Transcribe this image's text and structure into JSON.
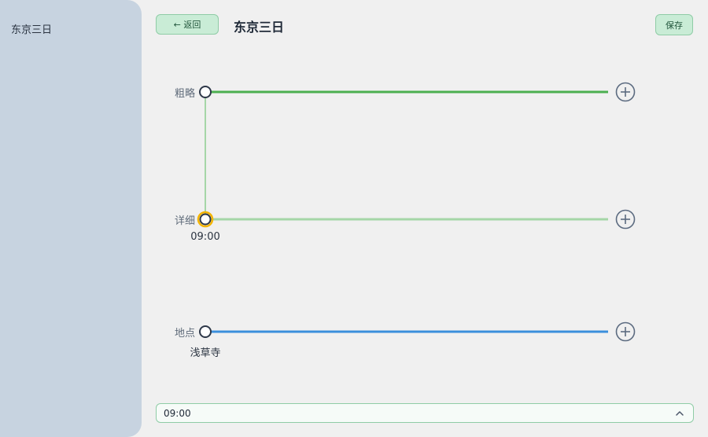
{
  "sidebar": {
    "items": [
      {
        "label": "东京三日"
      }
    ]
  },
  "header": {
    "back_label": "← 返回",
    "title": "东京三日",
    "save_label": "保存"
  },
  "lanes": [
    {
      "label": "粗略",
      "color": "#4caf50",
      "node_text": ""
    },
    {
      "label": "详细",
      "color": "#a5d6a7",
      "node_text": "09:00",
      "node_color": "#f4b400"
    },
    {
      "label": "地点",
      "color": "#3b8fdc",
      "node_text": "浅草寺"
    }
  ],
  "connector_color": "#a5d6a7",
  "bottom_input": {
    "value": "09:00"
  },
  "icons": {
    "add": "plus-circle-icon",
    "expand": "chevron-up-icon"
  }
}
